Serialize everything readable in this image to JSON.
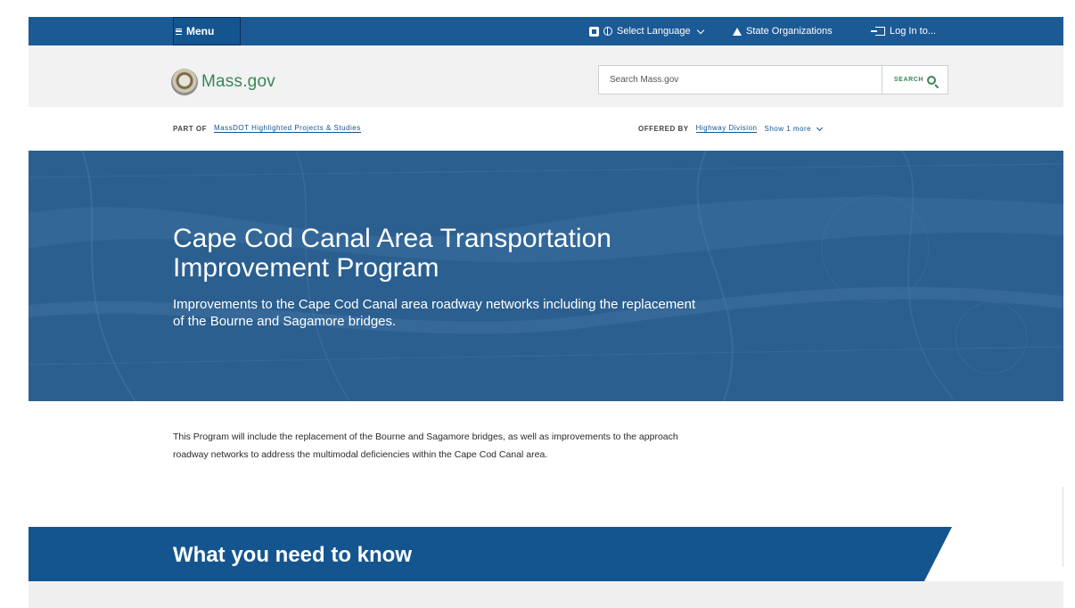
{
  "topbar": {
    "menu_label": "Menu",
    "translate_label": "Select Language",
    "orgs_label": "State Organizations",
    "login_label": "Log In to..."
  },
  "header": {
    "logo_text": "Mass.gov",
    "search_placeholder": "Search Mass.gov",
    "search_button": "SEARCH"
  },
  "meta": {
    "part_of_label": "PART OF",
    "part_of_link": "MassDOT Highlighted Projects & Studies",
    "offered_by_label": "OFFERED BY",
    "offered_by_link": "Highway Division",
    "show_more": "Show 1 more"
  },
  "hero": {
    "title": "Cape Cod Canal Area Transportation Improvement Program",
    "subtitle": "Improvements to the Cape Cod Canal area roadway networks including the replacement of the Bourne and Sagamore bridges."
  },
  "intro": {
    "text": "This Program will include the replacement of the Bourne and Sagamore bridges, as well as improvements to the approach roadway networks to address the multimodal deficiencies within the Cape Cod Canal area."
  },
  "section": {
    "title": "What you need to know"
  },
  "colors": {
    "topbar": "#1c5a96",
    "brand_blue": "#14558f",
    "brand_green": "#388557",
    "hero_bg": "#2b5f8f"
  },
  "icons": [
    "menu-icon",
    "google-translate-icon",
    "globe-icon",
    "chevron-down-icon",
    "building-icon",
    "login-icon",
    "state-seal-icon",
    "search-icon"
  ]
}
